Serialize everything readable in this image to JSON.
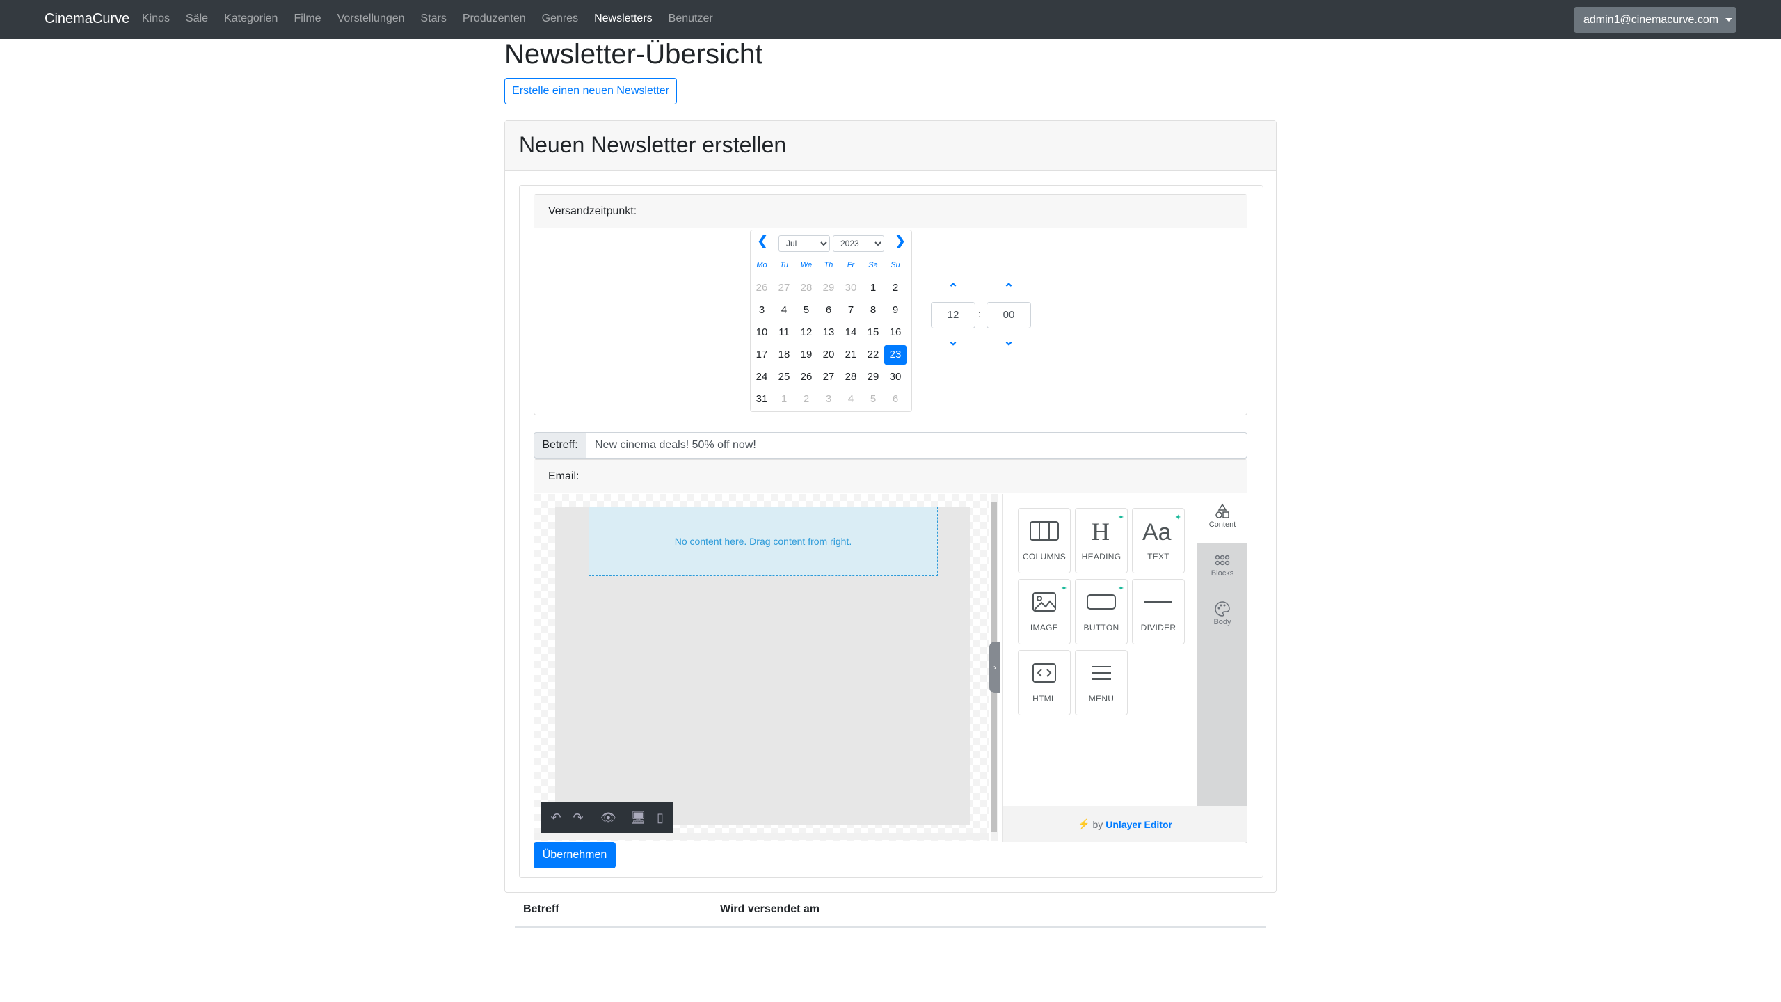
{
  "navbar": {
    "brand": "CinemaCurve",
    "links": [
      "Kinos",
      "Säle",
      "Kategorien",
      "Filme",
      "Vorstellungen",
      "Stars",
      "Produzenten",
      "Genres",
      "Newsletters",
      "Benutzer"
    ],
    "active": "Newsletters",
    "user": "admin1@cinemacurve.com"
  },
  "page": {
    "title": "Newsletter-Übersicht",
    "new_button": "Erstelle einen neuen Newsletter"
  },
  "form": {
    "title": "Neuen Newsletter erstellen",
    "schedule_label": "Versandzeitpunkt:",
    "calendar": {
      "month": "Jul",
      "year": "2023",
      "weekdays": [
        "Mo",
        "Tu",
        "We",
        "Th",
        "Fr",
        "Sa",
        "Su"
      ],
      "weeks": [
        [
          "26",
          "27",
          "28",
          "29",
          "30",
          "1",
          "2"
        ],
        [
          "3",
          "4",
          "5",
          "6",
          "7",
          "8",
          "9"
        ],
        [
          "10",
          "11",
          "12",
          "13",
          "14",
          "15",
          "16"
        ],
        [
          "17",
          "18",
          "19",
          "20",
          "21",
          "22",
          "23"
        ],
        [
          "24",
          "25",
          "26",
          "27",
          "28",
          "29",
          "30"
        ],
        [
          "31",
          "1",
          "2",
          "3",
          "4",
          "5",
          "6"
        ]
      ],
      "selected": "23"
    },
    "time": {
      "hour": "12",
      "separator": ":",
      "minute": "00"
    },
    "subject_label": "Betreff:",
    "subject_value": "New cinema deals! 50% off now!",
    "email_label": "Email:",
    "submit": "Übernehmen"
  },
  "editor": {
    "placeholder": "No content here. Drag content from right.",
    "tools": [
      {
        "label": "COLUMNS",
        "icon": "columns-icon"
      },
      {
        "label": "HEADING",
        "icon": "heading-icon"
      },
      {
        "label": "TEXT",
        "icon": "text-icon"
      },
      {
        "label": "IMAGE",
        "icon": "image-icon"
      },
      {
        "label": "BUTTON",
        "icon": "button-icon"
      },
      {
        "label": "DIVIDER",
        "icon": "divider-icon"
      },
      {
        "label": "HTML",
        "icon": "html-icon"
      },
      {
        "label": "MENU",
        "icon": "menu-icon"
      }
    ],
    "tabs": [
      "Content",
      "Blocks",
      "Body"
    ],
    "footer_prefix": "by",
    "footer_brand": "Unlayer Editor"
  },
  "table": {
    "columns": [
      "Betreff",
      "Wird versendet am"
    ]
  }
}
